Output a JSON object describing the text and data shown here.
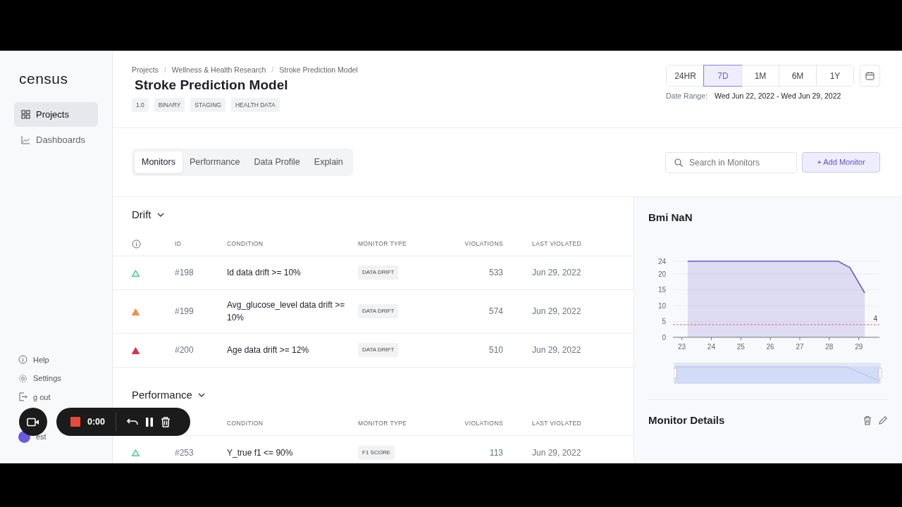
{
  "sidebar": {
    "logo": "census",
    "items": [
      {
        "label": "Projects",
        "selected": true
      },
      {
        "label": "Dashboards",
        "selected": false
      }
    ],
    "footer_items": [
      {
        "label": "Help"
      },
      {
        "label": "Settings"
      },
      {
        "label": "g out"
      }
    ],
    "user": {
      "name": "est"
    }
  },
  "breadcrumb": [
    {
      "label": "Projects"
    },
    {
      "separator": "/",
      "label": "Wellness & Health Research"
    },
    {
      "separator": "/",
      "label": "Stroke Prediction Model"
    }
  ],
  "title": "Stroke Prediction Model",
  "tags": [
    "1.0",
    "BINARY",
    "STAGING",
    "HEALTH DATA"
  ],
  "periods": [
    {
      "label": "24HR",
      "selected": false
    },
    {
      "label": "7D",
      "selected": true
    },
    {
      "label": "1M",
      "selected": false
    },
    {
      "label": "6M",
      "selected": false
    },
    {
      "label": "1Y",
      "selected": false
    }
  ],
  "date_range": {
    "label": "Date Range:",
    "value": "Wed Jun 22, 2022 - Wed Jun 29, 2022"
  },
  "tabs": [
    {
      "label": "Monitors",
      "selected": true
    },
    {
      "label": "Performance",
      "selected": false
    },
    {
      "label": "Data Profile",
      "selected": false
    },
    {
      "label": "Explain",
      "selected": false
    }
  ],
  "search": {
    "placeholder": "Search in Monitors"
  },
  "add_button": "+ Add Monitor",
  "sections": [
    {
      "title": "Drift",
      "columns": [
        {
          "kind": "status"
        },
        {
          "kind": "id",
          "label": "ID"
        },
        {
          "kind": "condition",
          "label": "CONDITION"
        },
        {
          "kind": "type",
          "label": "MONITOR TYPE"
        },
        {
          "kind": "violations",
          "label": "VIOLATIONS"
        },
        {
          "kind": "last",
          "label": "LAST VIOLATED"
        }
      ],
      "rows": [
        {
          "color": "#3cc48f",
          "outline": true,
          "id": "#198",
          "condition": "Id data drift >= 10%",
          "type": "DATA DRIFT",
          "violations": "533",
          "last": "Jun 29, 2022"
        },
        {
          "color": "#f0904a",
          "outline": false,
          "id": "#199",
          "condition": "Avg_glucose_level data drift >= 10%",
          "type": "DATA DRIFT",
          "violations": "574",
          "last": "Jun 29, 2022"
        },
        {
          "color": "#d9344f",
          "outline": false,
          "id": "#200",
          "condition": "Age data drift >= 12%",
          "type": "DATA DRIFT",
          "violations": "510",
          "last": "Jun 29, 2022"
        }
      ]
    },
    {
      "title": "Performance",
      "columns": [
        {
          "kind": "condition",
          "label": "CONDITION"
        },
        {
          "kind": "type",
          "label": "MONITOR TYPE"
        },
        {
          "kind": "violations",
          "label": "VIOLATIONS"
        },
        {
          "kind": "last",
          "label": "LAST VIOLATED"
        }
      ],
      "rows": [
        {
          "color": "#3cc48f",
          "outline": true,
          "id": "#253",
          "condition": "Y_true f1 <= 90%",
          "type": "F1 SCORE",
          "violations": "113",
          "last": "Jun 29, 2022"
        }
      ]
    }
  ],
  "panel": {
    "title": "Bmi NaN",
    "chart_data": {
      "type": "area",
      "x": [
        23.2,
        24,
        25,
        26,
        27,
        28,
        28.3,
        28.7,
        29.2
      ],
      "series": [
        {
          "color": "#6a5acd",
          "values": [
            24,
            24,
            24,
            24,
            24,
            24,
            24,
            22,
            14
          ]
        }
      ],
      "xticks": [
        23,
        24,
        25,
        26,
        27,
        28,
        29
      ],
      "yticks": [
        0,
        5,
        10,
        15,
        20,
        24
      ],
      "ylim": [
        0,
        24
      ],
      "xlim": [
        22.7,
        29.7
      ],
      "grid": true,
      "ref_lines": [
        {
          "axis": "y",
          "value": 4,
          "label": "4",
          "color": "#e0607a"
        }
      ]
    },
    "details_title": "Monitor Details"
  },
  "recorder": {
    "time": "0:00"
  }
}
